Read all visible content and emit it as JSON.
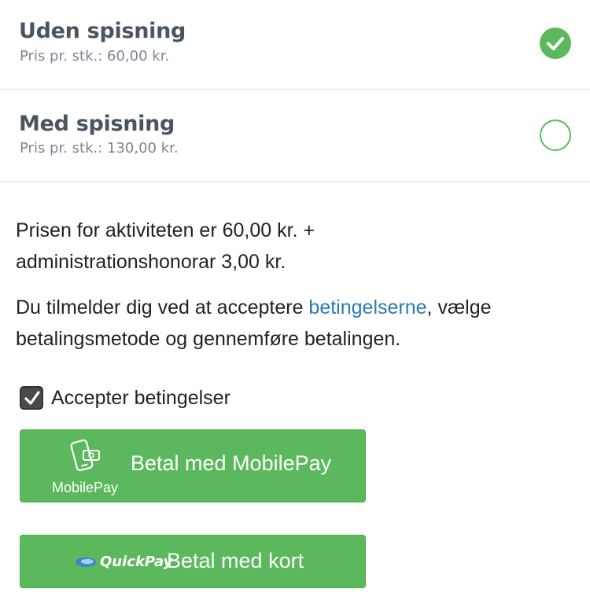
{
  "options": [
    {
      "title": "Uden spisning",
      "price": "Pris pr. stk.: 60,00 kr.",
      "selected": true
    },
    {
      "title": "Med spisning",
      "price": "Pris pr. stk.: 130,00 kr.",
      "selected": false
    }
  ],
  "info": {
    "price_line1": "Prisen for aktiviteten er 60,00 kr. +",
    "price_line2": "administrationshonorar 3,00 kr.",
    "terms_before": "Du tilmelder dig ved at acceptere ",
    "terms_link": "betingelserne",
    "terms_after": ", vælge",
    "terms_line2": "betalingsmetode og gennemføre betalingen."
  },
  "accept": {
    "label": "Accepter betingelser",
    "checked": true
  },
  "payment": {
    "mobilepay_logo_text": "MobilePay",
    "mobilepay_label": "Betal med MobilePay",
    "quickpay_logo_text": "QuickPay",
    "card_label": "Betal med kort"
  },
  "colors": {
    "accent_green": "#5cb85c",
    "link_blue": "#2a7ab8",
    "title_gray": "#4a5560"
  }
}
